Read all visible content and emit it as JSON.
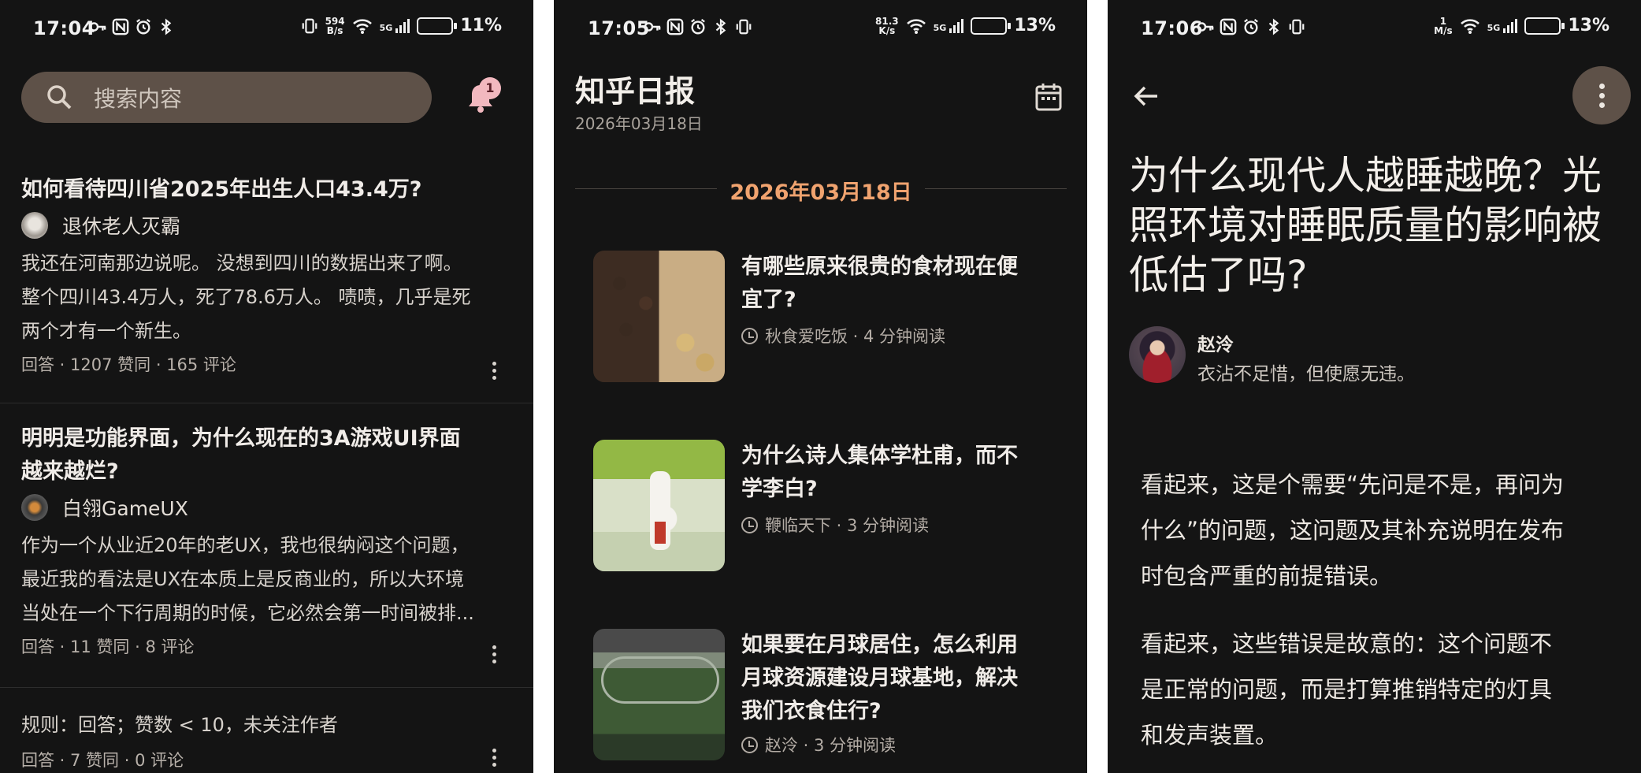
{
  "phone1": {
    "status": {
      "time": "17:04",
      "netspeed_top": "594",
      "netspeed_bottom": "B/s",
      "network": "5G",
      "battery": "11%"
    },
    "search": {
      "placeholder": "搜索内容"
    },
    "notifications": {
      "count": "1"
    },
    "feed": [
      {
        "title": "如何看待四川省2025年出生人口43.4万?",
        "author": "退休老人灭霸",
        "excerpt": [
          "我还在河南那边说呢。 没想到四川的数据出来了啊。",
          "整个四川43.4万人，死了78.6万人。 啧啧，几乎是死",
          "两个才有一个新生。"
        ],
        "meta": "回答 · 1207 赞同 · 165 评论"
      },
      {
        "title_lines": [
          "明明是功能界面，为什么现在的3A游戏UI界面",
          "越来越烂?"
        ],
        "author": "白翎GameUX",
        "excerpt": [
          "作为一个从业近20年的老UX，我也很纳闷这个问题，",
          "最近我的看法是UX在本质上是反商业的，所以大环境",
          "当处在一个下行周期的时候，它必然会第一时间被排..."
        ],
        "meta": "回答 · 11 赞同 · 8 评论"
      },
      {
        "rule": "规则：回答；赞数 < 10，未关注作者",
        "meta": "回答 · 7 赞同 · 0 评论"
      }
    ]
  },
  "phone2": {
    "status": {
      "time": "17:05",
      "netspeed_top": "81.3",
      "netspeed_bottom": "K/s",
      "network": "5G",
      "battery": "13%"
    },
    "header": {
      "title": "知乎日报",
      "date": "2026年03月18日"
    },
    "section_date": "2026年03月18日",
    "stories": [
      {
        "title_lines": [
          "有哪些原来很贵的食材现在便",
          "宜了?"
        ],
        "meta": "秋食爱吃饭 · 4 分钟阅读"
      },
      {
        "title_lines": [
          "为什么诗人集体学杜甫，而不",
          "学李白?"
        ],
        "meta": "鞭临天下 · 3 分钟阅读"
      },
      {
        "title_lines": [
          "如果要在月球居住，怎么利用",
          "月球资源建设月球基地，解决",
          "我们衣食住行?"
        ],
        "meta": "赵泠 · 3 分钟阅读"
      }
    ]
  },
  "phone3": {
    "status": {
      "time": "17:06",
      "netspeed_top": "1",
      "netspeed_bottom": "M/s",
      "network": "5G",
      "battery": "13%"
    },
    "article": {
      "title_lines": [
        "为什么现代人越睡越晚？光",
        "照环境对睡眠质量的影响被",
        "低估了吗?"
      ],
      "author": "赵泠",
      "bio": "衣沾不足惜，但使愿无违。",
      "paragraphs": [
        [
          "看起来，这是个需要“先问是不是，再问为",
          "什么”的问题，这问题及其补充说明在发布",
          "时包含严重的前提错误。"
        ],
        [
          "看起来，这些错误是故意的：这个问题不",
          "是正常的问题，而是打算推销特定的灯具",
          "和发声装置。"
        ]
      ]
    }
  }
}
